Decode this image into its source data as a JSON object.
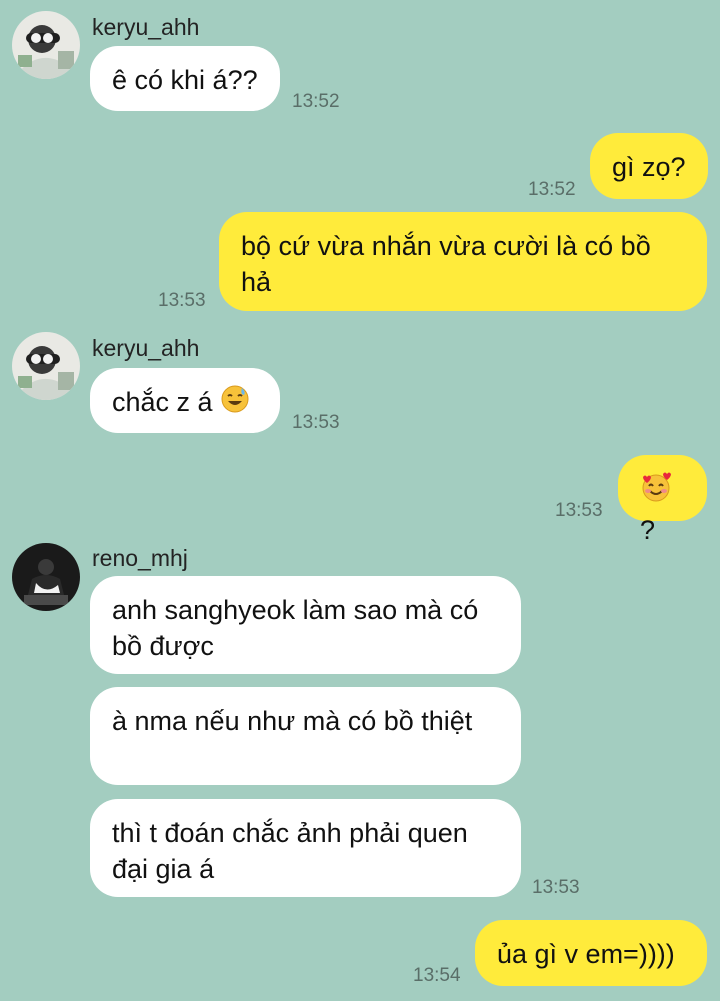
{
  "messages": [
    {
      "sender": "keryu_ahh",
      "text": "ê có khi á??",
      "time": "13:52"
    },
    {
      "text": "gì zọ?",
      "time": "13:52"
    },
    {
      "text": "bộ cứ vừa nhắn vừa cười là có bồ hả",
      "time": "13:53"
    },
    {
      "sender": "keryu_ahh",
      "text": "chắc z á",
      "emoji": "sweat-smile-emoji",
      "time": "13:53"
    },
    {
      "text": "?",
      "emoji": "smiling-face-with-hearts-emoji",
      "time": "13:53"
    },
    {
      "sender": "reno_mhj",
      "text": "anh sanghyeok làm sao mà có bồ được"
    },
    {
      "text": "à nma nếu như mà có bồ thiệt"
    },
    {
      "text": "thì t đoán chắc ảnh phải quen đại gia á",
      "time": "13:53"
    },
    {
      "text": "ủa gì v em=))))",
      "time": "13:54"
    }
  ],
  "colors": {
    "background": "#a3cdc0",
    "incoming_bubble": "#ffffff",
    "outgoing_bubble": "#ffeb3b"
  }
}
